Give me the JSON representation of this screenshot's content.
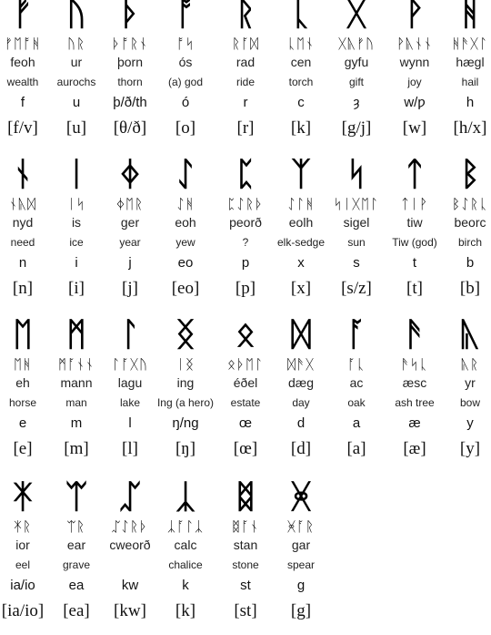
{
  "runes": [
    {
      "rune": "ᚠ",
      "spelling": "ᚠᛖᚩᚻ",
      "name": "feoh",
      "meaning": "wealth",
      "translit": "f",
      "ipa": "[f/v]"
    },
    {
      "rune": "ᚢ",
      "spelling": "ᚢᚱ",
      "name": "ur",
      "meaning": "aurochs",
      "translit": "u",
      "ipa": "[u]"
    },
    {
      "rune": "ᚦ",
      "spelling": "ᚦᚩᚱᚾ",
      "name": "þorn",
      "meaning": "thorn",
      "translit": "þ/ð/th",
      "ipa": "[θ/ð]"
    },
    {
      "rune": "ᚩ",
      "spelling": "ᚩᛋ",
      "name": "ós",
      "meaning": "(a) god",
      "translit": "ó",
      "ipa": "[o]"
    },
    {
      "rune": "ᚱ",
      "spelling": "ᚱᚪᛞ",
      "name": "rad",
      "meaning": "ride",
      "translit": "r",
      "ipa": "[r]"
    },
    {
      "rune": "ᚳ",
      "spelling": "ᚳᛖᚾ",
      "name": "cen",
      "meaning": "torch",
      "translit": "c",
      "ipa": "[k]"
    },
    {
      "rune": "ᚷ",
      "spelling": "ᚷᚣᚠᚢ",
      "name": "gyfu",
      "meaning": "gift",
      "translit": "ȝ",
      "ipa": "[g/j]"
    },
    {
      "rune": "ᚹ",
      "spelling": "ᚹᚣᚾᚾ",
      "name": "wynn",
      "meaning": "joy",
      "translit": "w/ƿ",
      "ipa": "[w]"
    },
    {
      "rune": "ᚻ",
      "spelling": "ᚻᚫᚷᛚ",
      "name": "hægl",
      "meaning": "hail",
      "translit": "h",
      "ipa": "[h/x]"
    },
    {
      "rune": "ᚾ",
      "spelling": "ᚾᚣᛞ",
      "name": "nyd",
      "meaning": "need",
      "translit": "n",
      "ipa": "[n]"
    },
    {
      "rune": "ᛁ",
      "spelling": "ᛁᛋ",
      "name": "is",
      "meaning": "ice",
      "translit": "i",
      "ipa": "[i]"
    },
    {
      "rune": "ᛄ",
      "spelling": "ᛄᛖᚱ",
      "name": "ger",
      "meaning": "year",
      "translit": "j",
      "ipa": "[j]"
    },
    {
      "rune": "ᛇ",
      "spelling": "ᛇᚻ",
      "name": "eoh",
      "meaning": "yew",
      "translit": "eo",
      "ipa": "[eo]"
    },
    {
      "rune": "ᛈ",
      "spelling": "ᛈᛇᚱᚦ",
      "name": "peorð",
      "meaning": "?",
      "translit": "p",
      "ipa": "[p]"
    },
    {
      "rune": "ᛉ",
      "spelling": "ᛇᛚᚻ",
      "name": "eolh",
      "meaning": "elk-sedge",
      "translit": "x",
      "ipa": "[x]"
    },
    {
      "rune": "ᛋ",
      "spelling": "ᛋᛁᚷᛖᛚ",
      "name": "sigel",
      "meaning": "sun",
      "translit": "s",
      "ipa": "[s/z]"
    },
    {
      "rune": "ᛏ",
      "spelling": "ᛏᛁᚹ",
      "name": "tiw",
      "meaning": "Tiw (god)",
      "translit": "t",
      "ipa": "[t]"
    },
    {
      "rune": "ᛒ",
      "spelling": "ᛒᛇᚱᚳ",
      "name": "beorc",
      "meaning": "birch",
      "translit": "b",
      "ipa": "[b]"
    },
    {
      "rune": "ᛖ",
      "spelling": "ᛖᚻ",
      "name": "eh",
      "meaning": "horse",
      "translit": "e",
      "ipa": "[e]"
    },
    {
      "rune": "ᛗ",
      "spelling": "ᛗᚪᚾᚾ",
      "name": "mann",
      "meaning": "man",
      "translit": "m",
      "ipa": "[m]"
    },
    {
      "rune": "ᛚ",
      "spelling": "ᛚᚪᚷᚢ",
      "name": "lagu",
      "meaning": "lake",
      "translit": "l",
      "ipa": "[l]"
    },
    {
      "rune": "ᛝ",
      "spelling": "ᛁᛝ",
      "name": "ing",
      "meaning": "Ing (a hero)",
      "translit": "ŋ/ng",
      "ipa": "[ŋ]"
    },
    {
      "rune": "ᛟ",
      "spelling": "ᛟᚦᛖᛚ",
      "name": "éðel",
      "meaning": "estate",
      "translit": "œ",
      "ipa": "[œ]"
    },
    {
      "rune": "ᛞ",
      "spelling": "ᛞᚫᚷ",
      "name": "dæg",
      "meaning": "day",
      "translit": "d",
      "ipa": "[d]"
    },
    {
      "rune": "ᚪ",
      "spelling": "ᚪᚳ",
      "name": "ac",
      "meaning": "oak",
      "translit": "a",
      "ipa": "[a]"
    },
    {
      "rune": "ᚫ",
      "spelling": "ᚫᛋᚳ",
      "name": "æsc",
      "meaning": "ash tree",
      "translit": "æ",
      "ipa": "[æ]"
    },
    {
      "rune": "ᚣ",
      "spelling": "ᚣᚱ",
      "name": "yr",
      "meaning": "bow",
      "translit": "y",
      "ipa": "[y]"
    },
    {
      "rune": "ᛡ",
      "spelling": "ᛡᚱ",
      "name": "ior",
      "meaning": "eel",
      "translit": "ia/io",
      "ipa": "[ia/io]"
    },
    {
      "rune": "ᛠ",
      "spelling": "ᛠᚱ",
      "name": "ear",
      "meaning": "grave",
      "translit": "ea",
      "ipa": "[ea]"
    },
    {
      "rune": "ᛢ",
      "spelling": "ᛢᛇᚱᚦ",
      "name": "cweorð",
      "meaning": "",
      "translit": "kw",
      "ipa": "[kw]"
    },
    {
      "rune": "ᛣ",
      "spelling": "ᛣᚪᛚᛣ",
      "name": "calc",
      "meaning": "chalice",
      "translit": "k",
      "ipa": "[k]"
    },
    {
      "rune": "ᛥ",
      "spelling": "ᛥᚪᚾ",
      "name": "stan",
      "meaning": "stone",
      "translit": "st",
      "ipa": "[st]"
    },
    {
      "rune": "ᚸ",
      "spelling": "ᚸᚪᚱ",
      "name": "gar",
      "meaning": "spear",
      "translit": "g",
      "ipa": "[g]"
    }
  ]
}
